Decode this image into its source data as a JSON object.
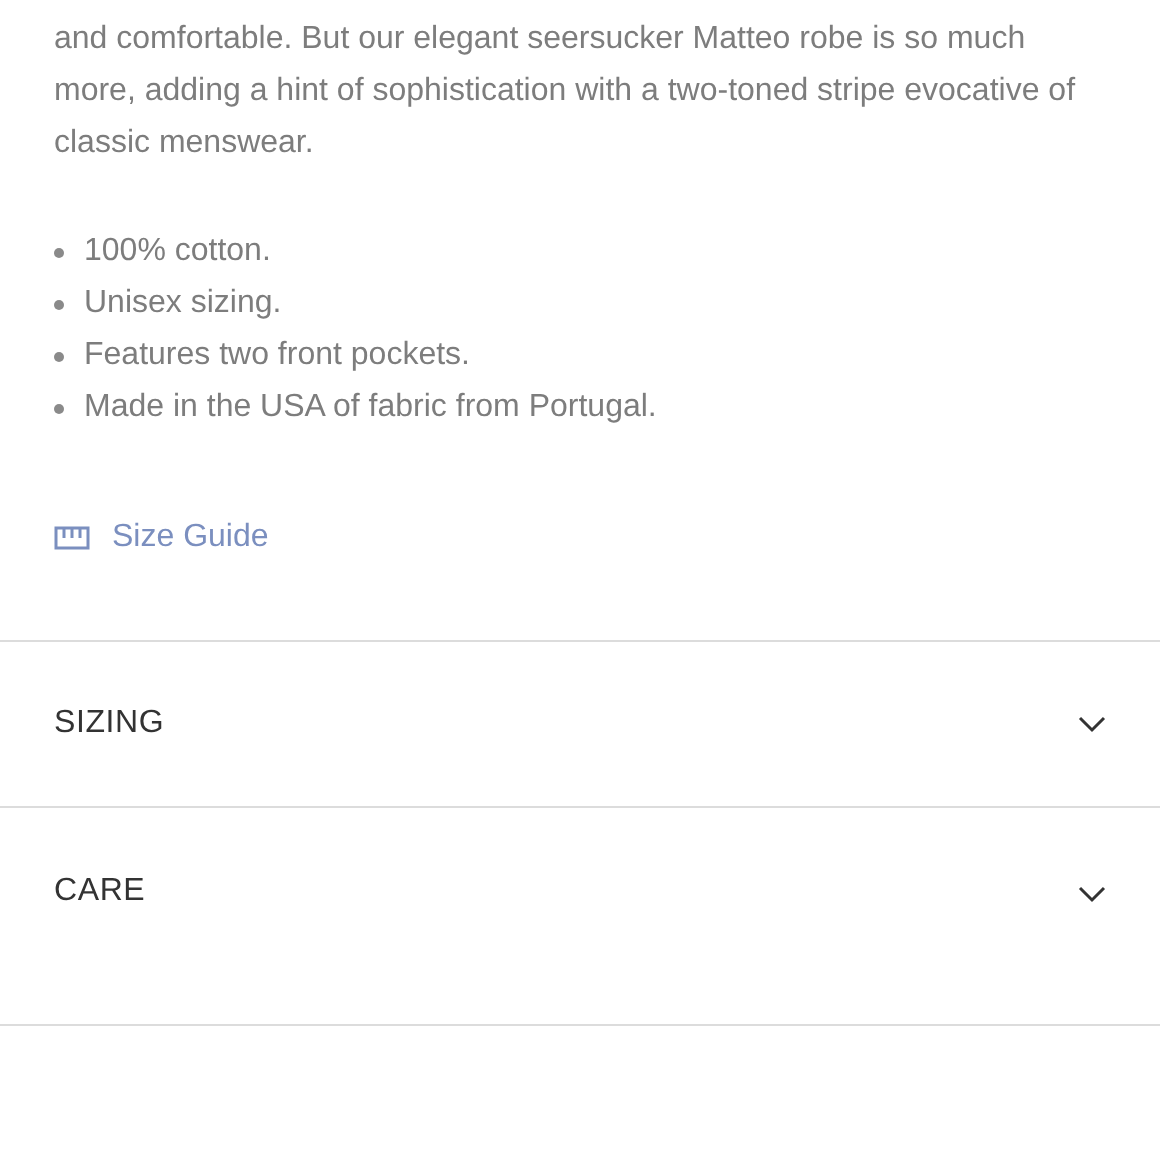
{
  "description": {
    "paragraph": "and comfortable. But our elegant seersucker Matteo robe is so much more, adding a hint of sophistication with a two-toned stripe evocative of classic menswear.",
    "bullets": [
      "100% cotton.",
      "Unisex sizing.",
      "Features two front pockets.",
      "Made in the USA of fabric from Portugal."
    ]
  },
  "size_guide_link": "Size Guide",
  "sections": [
    {
      "title": "SIZING",
      "expanded": false
    },
    {
      "title": "CARE",
      "expanded": false
    }
  ]
}
